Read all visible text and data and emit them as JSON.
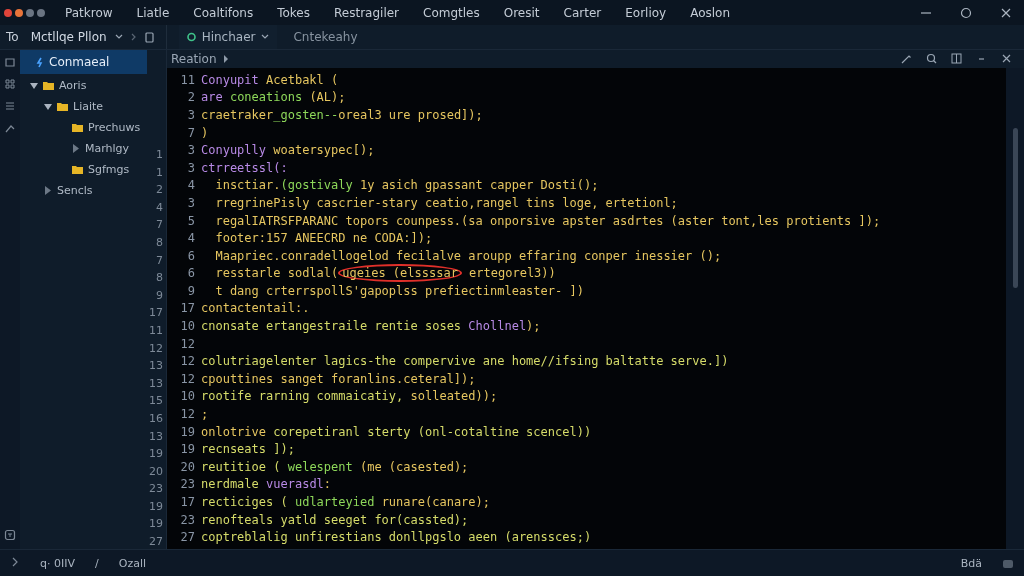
{
  "menu": [
    "Patkrow",
    "Liatle",
    "Coaltifons",
    "Tokes",
    "Restragiler",
    "Comgtles",
    "Oresit",
    "Carter",
    "Eorlioy",
    "Aoslon"
  ],
  "toolbar": {
    "label": "To",
    "project": "Mctllqe Pllon",
    "tabs": [
      {
        "label": "Hinchaer",
        "selected": true
      },
      {
        "label": "Cntekeahy",
        "selected": false
      }
    ]
  },
  "sidebar": {
    "items": [
      {
        "label": "Conmaeal",
        "selected": true,
        "kind": "command"
      },
      {
        "label": "Aoris",
        "selected": false,
        "kind": "folder",
        "expanded": true,
        "children": [
          {
            "label": "Liaite",
            "selected": false,
            "kind": "folder",
            "expanded": true,
            "children": [
              {
                "label": "Prechuws",
                "selected": false,
                "kind": "folder"
              },
              {
                "label": "Marhlgy",
                "selected": false,
                "kind": "collapsed"
              },
              {
                "label": "Sgfmgs",
                "selected": false,
                "kind": "folder"
              }
            ]
          }
        ]
      },
      {
        "label": "Sencls",
        "selected": false,
        "kind": "collapsed"
      }
    ],
    "gutter": [
      "1",
      "1",
      "2",
      "4",
      "7",
      "8",
      "7",
      "8",
      "9",
      "17",
      "11",
      "12",
      "13",
      "13",
      "15",
      "16",
      "13",
      "19",
      "20",
      "23",
      "19",
      "19",
      "27"
    ]
  },
  "editor": {
    "breadcrumb": "Reation",
    "lines": [
      {
        "num": "11",
        "tokens": [
          {
            "text": "Conyupit",
            "kind": "kw"
          },
          {
            "text": " Acetbakl (",
            "kind": "str"
          }
        ]
      },
      {
        "num": "2",
        "tokens": [
          {
            "text": "are",
            "kind": "kw"
          },
          {
            "text": " coneations",
            "kind": "fn"
          },
          {
            "text": " (AL);",
            "kind": "str"
          }
        ]
      },
      {
        "num": "3",
        "tokens": [
          {
            "text": "craetraker",
            "kind": "str"
          },
          {
            "text": "_gosten--",
            "kind": "fn"
          },
          {
            "text": "oreal3 ure prosed]);",
            "kind": "str"
          }
        ]
      },
      {
        "num": "7",
        "tokens": [
          {
            "text": ")",
            "kind": "str"
          }
        ]
      },
      {
        "num": "3",
        "tokens": [
          {
            "text": "Conyuplly",
            "kind": "kw"
          },
          {
            "text": " woatersypec[);",
            "kind": "str"
          }
        ]
      },
      {
        "num": "3",
        "tokens": [
          {
            "text": "ctrreetssl(:",
            "kind": "kw"
          }
        ]
      },
      {
        "num": "4",
        "tokens": [
          {
            "text": "  insctiar.",
            "kind": "str"
          },
          {
            "text": "(gostivaly",
            "kind": "fn"
          },
          {
            "text": " 1y asich gpassant capper Dosti();",
            "kind": "str"
          }
        ]
      },
      {
        "num": "3",
        "tokens": [
          {
            "text": "  rregrinePisly cascrier-stary ceatio,rangel tins loge, ertetionl;",
            "kind": "str"
          }
        ]
      },
      {
        "num": "5",
        "tokens": [
          {
            "text": "  regalIATRSFPARANC topors counpess.(sa onporsive apster asdrtes (aster tont,les protients ]);",
            "kind": "str"
          }
        ]
      },
      {
        "num": "4",
        "tokens": [
          {
            "text": "  footer:157 ANEECRD ne CODA:]);",
            "kind": "str"
          }
        ]
      },
      {
        "num": "6",
        "tokens": [
          {
            "text": "  Maapriec.conradellogelod fecilalve aroupp effaring conper inessier ();",
            "kind": "str"
          }
        ]
      },
      {
        "num": "6",
        "tokens": [
          {
            "text": "  resstarle sodlal(",
            "kind": "str"
          },
          {
            "text": "ugeies (elssssar",
            "kind": "circled"
          },
          {
            "text": " ertegorel3))",
            "kind": "str"
          }
        ]
      },
      {
        "num": "9",
        "tokens": [
          {
            "text": "  t dang crterrspollS'gapoplss prefiectinmleaster- ])",
            "kind": "str"
          }
        ]
      },
      {
        "num": "17",
        "tokens": [
          {
            "text": "contactentail:.",
            "kind": "str"
          }
        ]
      },
      {
        "num": "10",
        "tokens": [
          {
            "text": "cnonsate ertangestraile rentie soses ",
            "kind": "id"
          },
          {
            "text": "Chollnel",
            "kind": "kw"
          },
          {
            "text": ");",
            "kind": "str"
          }
        ]
      },
      {
        "num": "12"
      },
      {
        "num": "12",
        "tokens": [
          {
            "text": "colutriagelenter lagics-the compervive ane home//ifsing baltatte serve.])",
            "kind": "id"
          }
        ]
      },
      {
        "num": "12",
        "tokens": [
          {
            "text": "cpouttines sanget foranlins.ceteral]);",
            "kind": "str"
          }
        ]
      },
      {
        "num": "10",
        "tokens": [
          {
            "text": "rootife rarning commaicatiy,",
            "kind": "id"
          },
          {
            "text": " solleated));",
            "kind": "str"
          }
        ]
      },
      {
        "num": "12",
        "tokens": [
          {
            "text": ";",
            "kind": "str"
          }
        ]
      },
      {
        "num": "19",
        "tokens": [
          {
            "text": "onlotrive",
            "kind": "str"
          },
          {
            "text": " corepetiranl sterty (onl-cotaltine scencel))",
            "kind": "id"
          }
        ]
      },
      {
        "num": "19",
        "tokens": [
          {
            "text": "recnseats ]);",
            "kind": "id"
          }
        ]
      },
      {
        "num": "20",
        "tokens": [
          {
            "text": "reutitioe (",
            "kind": "id"
          },
          {
            "text": " welespent",
            "kind": "fn"
          },
          {
            "text": " (me (casested);",
            "kind": "str"
          }
        ]
      },
      {
        "num": "23",
        "tokens": [
          {
            "text": "nerdmale ",
            "kind": "id"
          },
          {
            "text": "vuerasdl",
            "kind": "kw"
          },
          {
            "text": ":",
            "kind": "str"
          }
        ]
      },
      {
        "num": "17",
        "tokens": [
          {
            "text": "recticiges (",
            "kind": "id"
          },
          {
            "text": " udlarteyied",
            "kind": "fn"
          },
          {
            "text": " runare(canare);",
            "kind": "str"
          }
        ]
      },
      {
        "num": "23",
        "tokens": [
          {
            "text": "renofteals yatld seeget for(cassted);",
            "kind": "id"
          }
        ]
      },
      {
        "num": "27",
        "tokens": [
          {
            "text": "coptreblalig unfirestians donllpgslo aeen (arenssces;)",
            "kind": "id"
          }
        ]
      }
    ]
  },
  "status_bar": {
    "left": [
      "q· 0IIV",
      "/",
      "Ozall"
    ],
    "right": "Bdä"
  }
}
